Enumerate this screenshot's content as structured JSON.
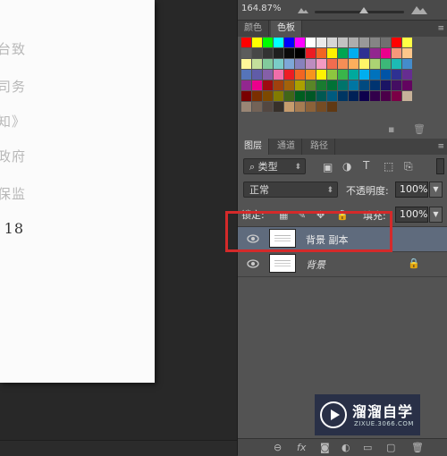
{
  "document": {
    "lines": [
      "台致",
      "司务",
      "知》",
      "政府",
      "保监",
      "18"
    ]
  },
  "navigator": {
    "zoom": "164.87%",
    "zoom_level_fraction": 0.55
  },
  "color_panel": {
    "tabs": [
      "颜色",
      "色板"
    ],
    "active_tab": "色板",
    "swatches": [
      "#ff0000",
      "#ffff00",
      "#00ff00",
      "#00ffff",
      "#0000ff",
      "#ff00ff",
      "#ffffff",
      "#ebebeb",
      "#d6d6d6",
      "#c2c2c2",
      "#adadad",
      "#999999",
      "#858585",
      "#707070",
      "#ff0000",
      "#ffff44",
      "#5c5c5c",
      "#474747",
      "#333333",
      "#1f1f1f",
      "#0a0a0a",
      "#000000",
      "#ec1c24",
      "#f26522",
      "#fff200",
      "#00a651",
      "#00aeef",
      "#2e3192",
      "#92278f",
      "#ec008c",
      "#f7977a",
      "#fdc68a",
      "#fff799",
      "#c4df9b",
      "#82ca9c",
      "#7accc8",
      "#7ea7d8",
      "#8781bd",
      "#bd8cbf",
      "#f49ac2",
      "#f26c4f",
      "#f68e56",
      "#fbaf5d",
      "#fff568",
      "#acd373",
      "#3cb878",
      "#1cbbb4",
      "#448ccb",
      "#5574b9",
      "#605ca8",
      "#855fa8",
      "#f06eaa",
      "#ed1c24",
      "#f26522",
      "#f7941d",
      "#fff200",
      "#8dc63f",
      "#39b54a",
      "#00a99d",
      "#00aeef",
      "#0072bc",
      "#0054a6",
      "#2e3192",
      "#662d91",
      "#92278f",
      "#ec008c",
      "#9e0b0f",
      "#a0410d",
      "#a36209",
      "#aba000",
      "#598527",
      "#197b30",
      "#007236",
      "#00746b",
      "#0076a3",
      "#004a80",
      "#003471",
      "#1b1464",
      "#440e62",
      "#630460",
      "#790000",
      "#7b2e00",
      "#7d4900",
      "#827b00",
      "#406618",
      "#005e20",
      "#005826",
      "#005952",
      "#005b7f",
      "#003663",
      "#002157",
      "#0d004c",
      "#32004b",
      "#4b0049",
      "#7b0046",
      "#c7b299",
      "#998675",
      "#736357",
      "#534741",
      "#37302a",
      "#c69c6d",
      "#a67c52",
      "#8c6239",
      "#754c24",
      "#603913"
    ]
  },
  "layers_panel": {
    "tabs": [
      "图层",
      "通道",
      "路径"
    ],
    "active_tab": "图层",
    "filter_type": "类型",
    "blend_mode": "正常",
    "opacity_label": "不透明度:",
    "opacity_value": "100%",
    "lock_label": "锁定:",
    "fill_label": "填充:",
    "fill_value": "100%",
    "layers": [
      {
        "name": "背景 副本",
        "selected": true,
        "locked": false
      },
      {
        "name": "背景",
        "selected": false,
        "locked": true
      }
    ],
    "bottom_icons": [
      "link-icon",
      "fx-icon",
      "mask-icon",
      "adjustment-icon",
      "group-icon",
      "new-layer-icon",
      "trash-icon"
    ]
  },
  "watermark": {
    "text": "溜溜自学",
    "sub": "ZIXUE.3066.COM"
  }
}
